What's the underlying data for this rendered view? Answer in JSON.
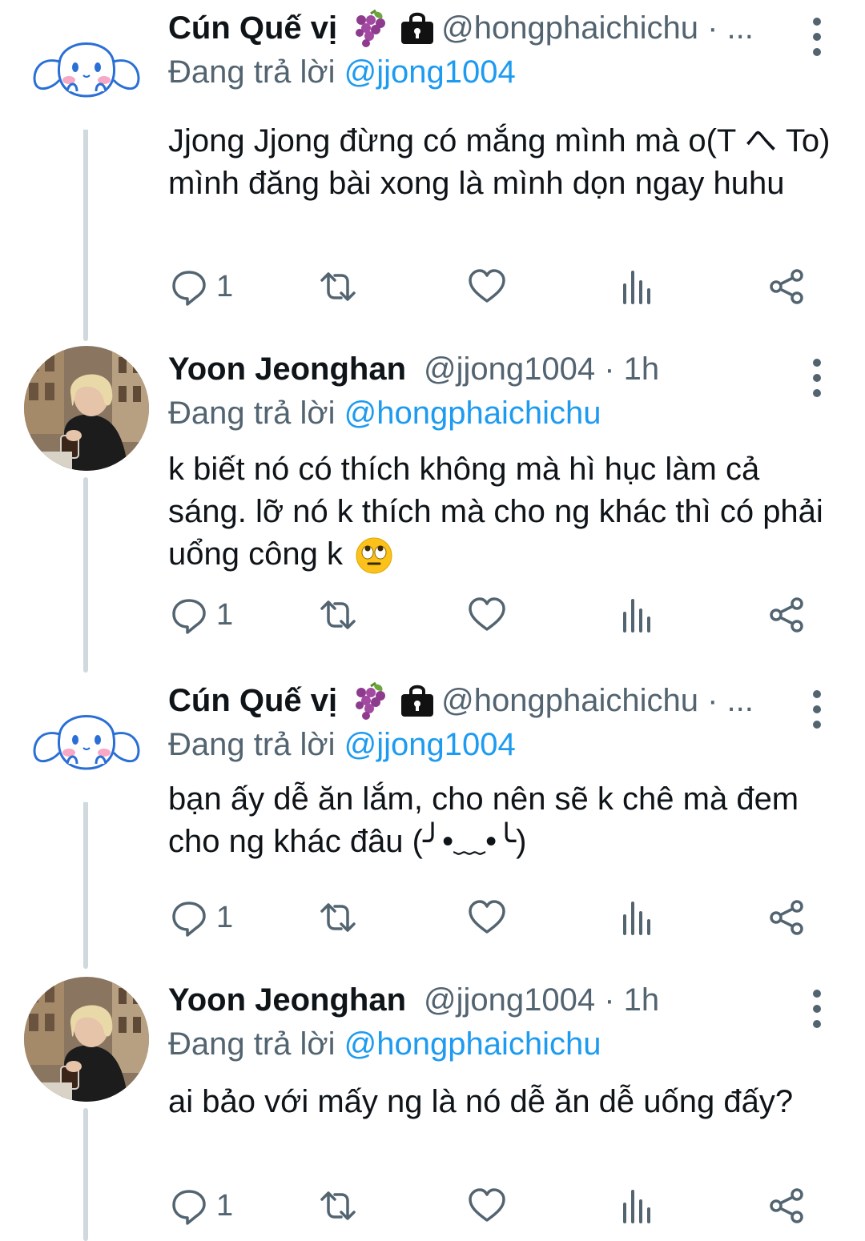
{
  "accent_color": "#1d9bf0",
  "secondary_text_color": "#536471",
  "reply_prefix": "Đang trả lời",
  "tweets": [
    {
      "name": "Cún Quế vị",
      "badges": [
        "grapes-emoji",
        "lock-icon"
      ],
      "handle_line": "@hongphaichichu · ...",
      "reply_to": "@jjong1004",
      "text": "Jjong Jjong đừng có mắng mình mà o(T へ To) mình đăng bài xong là mình dọn ngay huhu",
      "reply_count": "1",
      "avatar": "cinnamoroll-avatar"
    },
    {
      "name": "Yoon Jeonghan",
      "handle_line": "@jjong1004 · 1h",
      "reply_to": "@hongphaichichu",
      "text": "k biết nó có thích không mà hì hục làm cả sáng. lỡ nó k thích mà cho ng khác thì có phải uổng công k",
      "text_emoji": "eye-roll-emoji",
      "reply_count": "1",
      "avatar": "photo-avatar"
    },
    {
      "name": "Cún Quế vị",
      "badges": [
        "grapes-emoji",
        "lock-icon"
      ],
      "handle_line": "@hongphaichichu · ...",
      "reply_to": "@jjong1004",
      "text": "bạn ấy dễ ăn lắm, cho nên sẽ k chê mà đem cho ng khác đâu (╯•﹏•╰)",
      "reply_count": "1",
      "avatar": "cinnamoroll-avatar"
    },
    {
      "name": "Yoon Jeonghan",
      "handle_line": "@jjong1004 · 1h",
      "reply_to": "@hongphaichichu",
      "text": "ai bảo với mấy ng là nó dễ ăn dễ uống đấy?",
      "reply_count": "1",
      "avatar": "photo-avatar"
    }
  ]
}
